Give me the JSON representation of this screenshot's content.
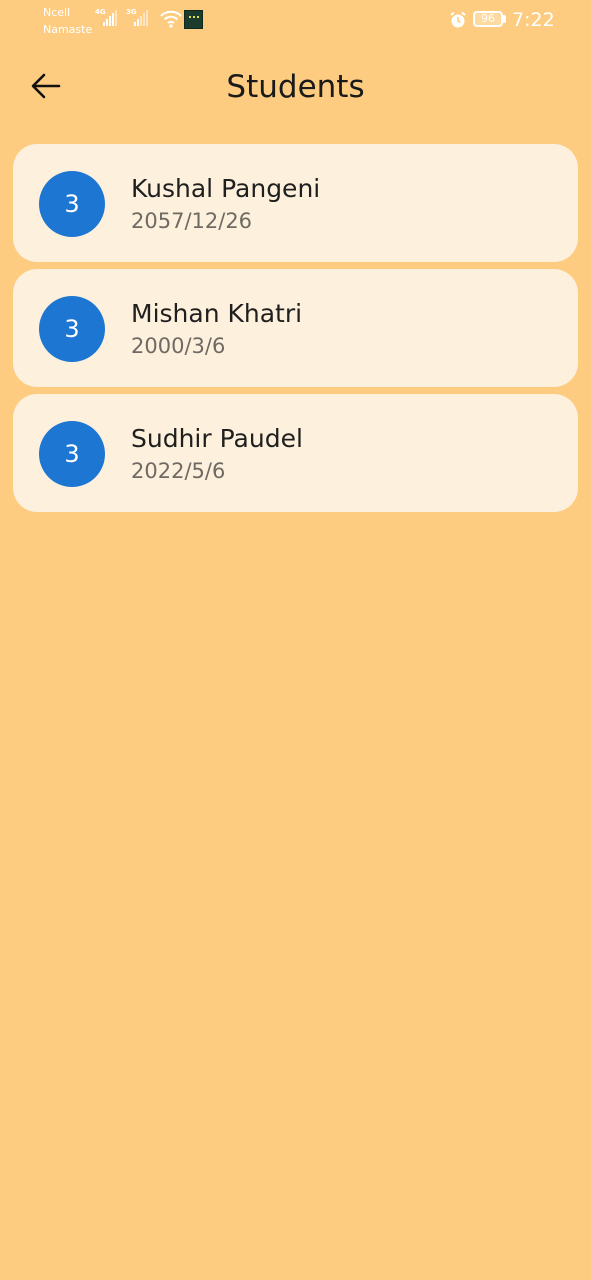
{
  "status_bar": {
    "carrier_line1": "Ncell",
    "carrier_line2": "Namaste",
    "network1": "4G",
    "network2": "3G",
    "battery": "96",
    "time": "7:22"
  },
  "header": {
    "title": "Students",
    "back_icon": "arrow-left-icon"
  },
  "students": [
    {
      "avatar": "3",
      "name": "Kushal Pangeni",
      "date": "2057/12/26"
    },
    {
      "avatar": "3",
      "name": "Mishan Khatri",
      "date": "2000/3/6"
    },
    {
      "avatar": "3",
      "name": "Sudhir Paudel",
      "date": "2022/5/6"
    }
  ],
  "colors": {
    "background": "#FECC80",
    "card": "#FDF0DD",
    "avatar": "#1C76D2"
  }
}
